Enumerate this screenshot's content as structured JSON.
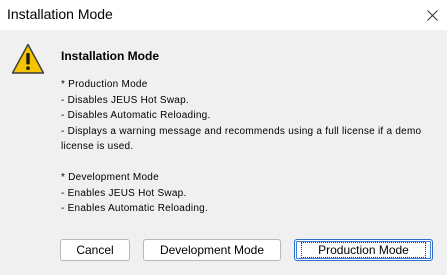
{
  "window": {
    "title": "Installation Mode",
    "close_glyph": "✕"
  },
  "icon": "warning-icon",
  "heading": "Installation Mode",
  "body": {
    "production": [
      "* Production Mode",
      "- Disables JEUS Hot Swap.",
      "- Disables Automatic Reloading.",
      "- Displays a warning message and recommends using a full license if a demo",
      "license is used."
    ],
    "development": [
      "* Development Mode",
      "- Enables JEUS Hot Swap.",
      "- Enables Automatic Reloading."
    ]
  },
  "buttons": {
    "cancel": "Cancel",
    "development": "Development Mode",
    "production": "Production Mode"
  },
  "colors": {
    "background": "#f0f0f0",
    "titlebar": "#ffffff",
    "warning_fill": "#f5c400",
    "default_button_border": "#2a6fc9"
  }
}
